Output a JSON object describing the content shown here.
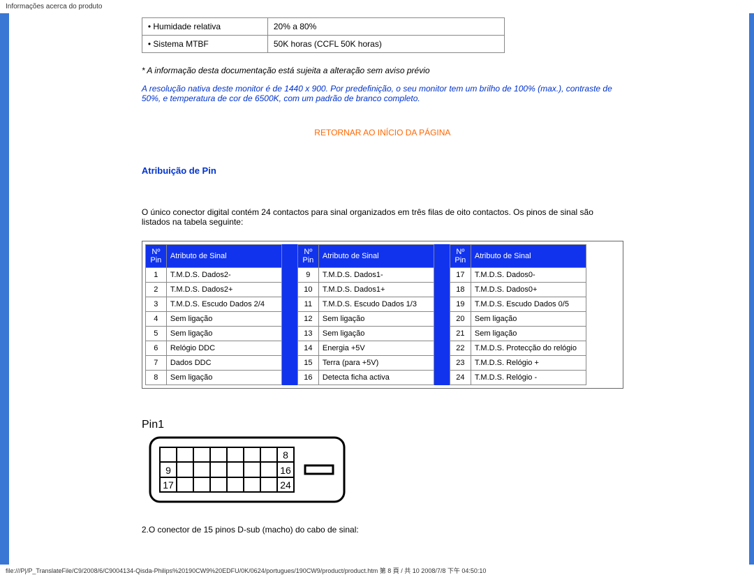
{
  "header": "Informações acerca do produto",
  "env_rows": [
    {
      "label": "• Humidade relativa",
      "value": "20% a 80%"
    },
    {
      "label": "• Sistema MTBF",
      "value": "50K horas (CCFL 50K horas)"
    }
  ],
  "note_italic": "* A informação desta documentação está sujeita a alteração sem aviso prévio",
  "note_blue": "A resolução nativa deste monitor é de 1440 x 900. Por predefinição, o seu monitor tem um brilho de 100% (max.), contraste de 50%, e temperatura de cor de 6500K, com um padrão de branco completo.",
  "return_link": "RETORNAR AO INÍCIO DA PÁGINA",
  "section_title": "Atribuição de Pin",
  "section_text": "O único conector digital contém 24 contactos para sinal organizados em três filas de oito contactos. Os pinos de sinal são listados na tabela seguinte:",
  "pin_header_no": "Nº Pin",
  "pin_header_attr": "Atributo de Sinal",
  "pin_tables": [
    [
      {
        "n": "1",
        "a": "T.M.D.S. Dados2-"
      },
      {
        "n": "2",
        "a": "T.M.D.S. Dados2+"
      },
      {
        "n": "3",
        "a": "T.M.D.S. Escudo Dados 2/4"
      },
      {
        "n": "4",
        "a": "Sem ligação"
      },
      {
        "n": "5",
        "a": "Sem ligação"
      },
      {
        "n": "6",
        "a": "Relógio DDC"
      },
      {
        "n": "7",
        "a": "Dados DDC"
      },
      {
        "n": "8",
        "a": "Sem ligação"
      }
    ],
    [
      {
        "n": "9",
        "a": "T.M.D.S. Dados1-"
      },
      {
        "n": "10",
        "a": "T.M.D.S. Dados1+"
      },
      {
        "n": "11",
        "a": "T.M.D.S. Escudo Dados 1/3"
      },
      {
        "n": "12",
        "a": "Sem ligação"
      },
      {
        "n": "13",
        "a": "Sem ligação"
      },
      {
        "n": "14",
        "a": "Energia +5V"
      },
      {
        "n": "15",
        "a": "Terra (para +5V)"
      },
      {
        "n": "16",
        "a": "Detecta ficha activa"
      }
    ],
    [
      {
        "n": "17",
        "a": "T.M.D.S. Dados0-"
      },
      {
        "n": "18",
        "a": "T.M.D.S. Dados0+"
      },
      {
        "n": "19",
        "a": "T.M.D.S. Escudo Dados 0/5"
      },
      {
        "n": "20",
        "a": "Sem ligação"
      },
      {
        "n": "21",
        "a": "Sem ligação"
      },
      {
        "n": "22",
        "a": "T.M.D.S. Protecção do relógio"
      },
      {
        "n": "23",
        "a": "T.M.D.S. Relógio +"
      },
      {
        "n": "24",
        "a": "T.M.D.S. Relógio -"
      }
    ]
  ],
  "diagram_labels": {
    "pin1": "Pin1",
    "p8": "8",
    "p9": "9",
    "p16": "16",
    "p17": "17",
    "p24": "24"
  },
  "footer_note": "2.O conector de 15 pinos D-sub (macho) do cabo de sinal:",
  "footer_path": "file:///P|/P_TranslateFile/C9/2008/6/C9004134-Qisda-Philips%20190CW9%20EDFU/0K/0624/portugues/190CW9/product/product.htm 第 8 頁 / 共 10 2008/7/8 下午 04:50:10"
}
